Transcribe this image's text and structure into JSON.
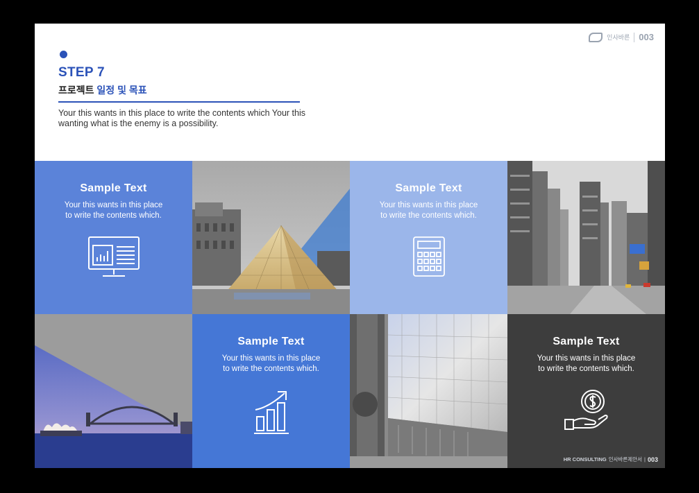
{
  "header": {
    "step": "STEP 7",
    "subtitle_plain": "프로젝트 ",
    "subtitle_accent": "일정 및 목표",
    "description": "Your this wants in this place to write the contents which Your this wanting what is the enemy is a possibility."
  },
  "brand": {
    "logo_text": "인사바른",
    "page_number": "003"
  },
  "cards": [
    {
      "title": "Sample Text",
      "body": "Your this wants in this place to write the contents which.",
      "icon": "monitor-chart-icon",
      "color": "#5b83d9"
    },
    {
      "title": "Sample Text",
      "body": "Your this wants in this place to write the contents which.",
      "icon": "calculator-icon",
      "color": "#9bb6ea"
    },
    {
      "title": "Sample Text",
      "body": "Your this wants in this place to write the contents which.",
      "icon": "growth-chart-icon",
      "color": "#4577d6"
    },
    {
      "title": "Sample Text",
      "body": "Your this wants in this place to write the contents which.",
      "icon": "coin-hand-icon",
      "color": "#3d3d3d"
    }
  ],
  "photos": [
    {
      "icon": "louvre-pyramid-photo"
    },
    {
      "icon": "city-street-photo"
    },
    {
      "icon": "sydney-harbour-photo"
    },
    {
      "icon": "glass-building-photo"
    }
  ],
  "footer": {
    "company": "HR CONSULTING",
    "korean": "인사바른제안서",
    "sep": "|",
    "page": "003"
  },
  "colors": {
    "accent": "#2b52b8",
    "slide_bg": "#ffffff"
  }
}
